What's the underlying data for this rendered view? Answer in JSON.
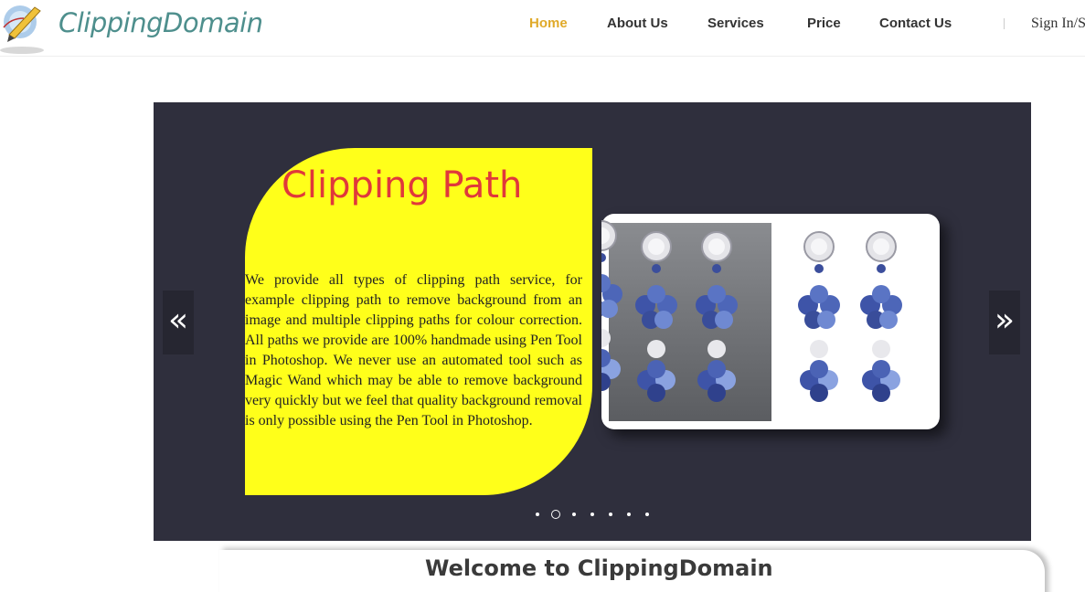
{
  "brand": {
    "name": "ClippingDomain",
    "color": "#4e8f8d"
  },
  "nav": {
    "items": [
      {
        "label": "Home",
        "active": true
      },
      {
        "label": "About Us"
      },
      {
        "label": "Services"
      },
      {
        "label": "Price"
      },
      {
        "label": "Contact Us"
      }
    ],
    "signin_label": "Sign In/S",
    "active_color": "#e0aa2a"
  },
  "hero": {
    "title": "Clipping Path",
    "text": "We provide all types of clipping path service, for example clipping path to remove background from an image and multiple clipping paths for colour correction. All paths we provide are 100% handmade using Pen Tool in Photoshop. We never use an automated tool such as Magic Wand which may be able to remove background very quickly but we feel that quality background removal is only possible using the Pen Tool in Photoshop.",
    "prev_arrow": "«",
    "next_arrow": "»",
    "slide_count": 7,
    "active_slide": 2,
    "colors": {
      "background": "#2f2f3d",
      "card": "#ffff1a",
      "title": "#e0383b"
    }
  },
  "welcome": {
    "title": "Welcome to ClippingDomain"
  }
}
